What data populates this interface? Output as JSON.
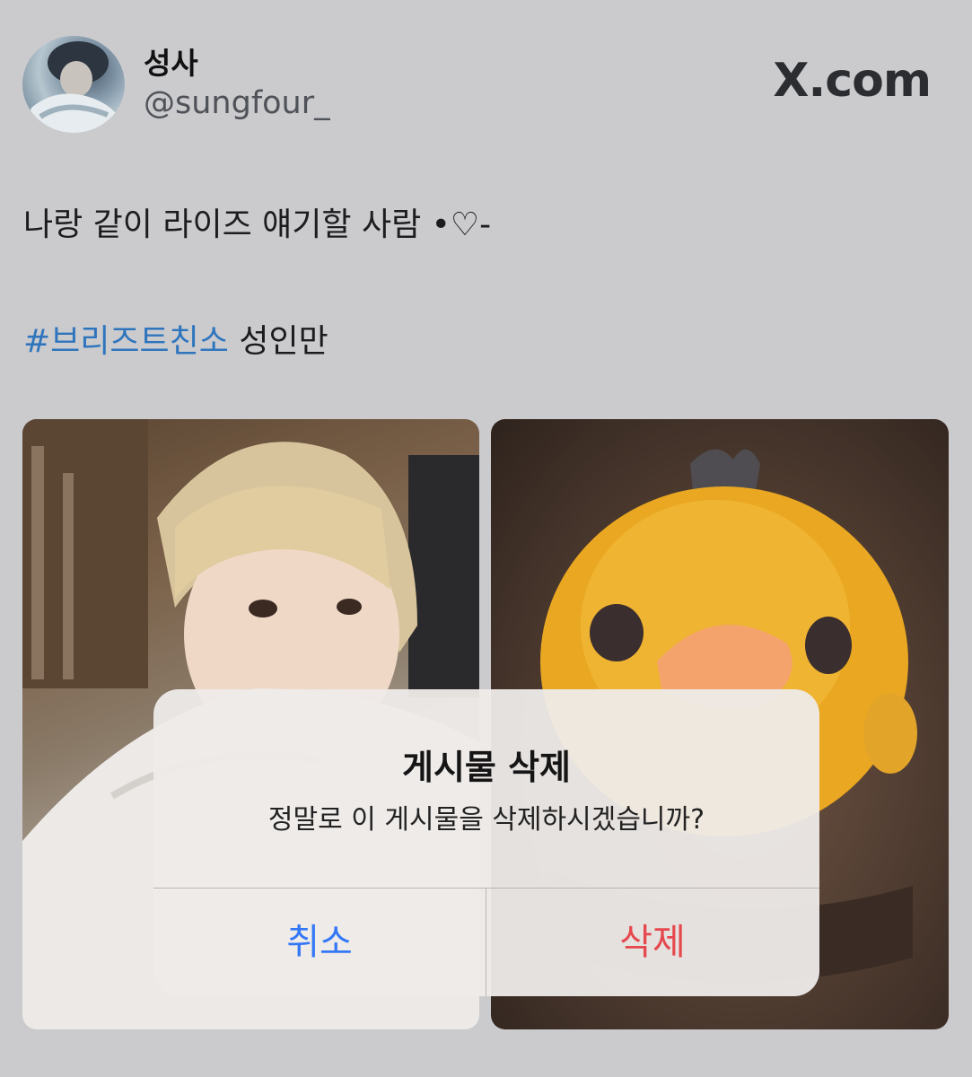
{
  "profile": {
    "display_name": "성사",
    "handle": "@sungfour_"
  },
  "brand": {
    "label": "X.com"
  },
  "tweet": {
    "text_line1": "나랑 같이 라이즈 얘기할 사람 •♡-",
    "hashtag": "#브리즈트친소",
    "text_line2_suffix": " 성인만"
  },
  "dialog": {
    "title": "게시물 삭제",
    "message": "정말로 이 게시물을 삭제하시겠습니까?",
    "cancel_label": "취소",
    "delete_label": "삭제"
  },
  "colors": {
    "background": "#cbcbce",
    "hashtag": "#2f75bd",
    "cancel": "#3478f6",
    "destructive": "#e5484d"
  }
}
